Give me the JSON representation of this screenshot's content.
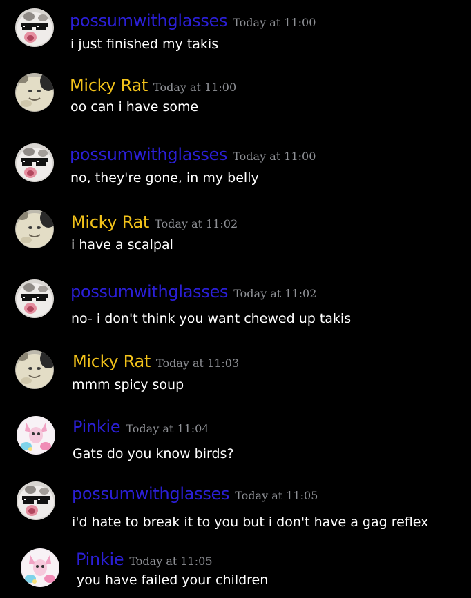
{
  "colors": {
    "background": "#000000",
    "possum_name": "#2b1fd6",
    "rat_name": "#f2c21a",
    "pinkie_name": "#2b1fd6",
    "timestamp": "#8e9095",
    "message_text": "#ffffff"
  },
  "messages": [
    {
      "author": "possumwithglasses",
      "avatar": "possum-avatar",
      "time": "Today at 11:00",
      "text": "i just finished my takis"
    },
    {
      "author": "Micky Rat",
      "avatar": "rat-avatar",
      "time": "Today at 11:00",
      "text": "oo can i have some"
    },
    {
      "author": "possumwithglasses",
      "avatar": "possum-avatar",
      "time": "Today at 11:00",
      "text": "no, they're gone, in my belly"
    },
    {
      "author": "Micky Rat",
      "avatar": "rat-avatar",
      "time": "Today at 11:02",
      "text": "i have a scalpal"
    },
    {
      "author": "possumwithglasses",
      "avatar": "possum-avatar",
      "time": "Today at 11:02",
      "text": "no- i don't think you want chewed up takis"
    },
    {
      "author": "Micky Rat",
      "avatar": "rat-avatar",
      "time": "Today at 11:03",
      "text": "mmm spicy soup"
    },
    {
      "author": "Pinkie",
      "avatar": "pinkie-avatar",
      "time": "Today at 11:04",
      "text": "Gats do you know birds?"
    },
    {
      "author": "possumwithglasses",
      "avatar": "possum-avatar",
      "time": "Today at 11:05",
      "text": "i'd hate to break it to you but i don't have a gag reflex"
    },
    {
      "author": "Pinkie",
      "avatar": "pinkie-avatar",
      "time": "Today at 11:05",
      "text": "you have failed your children"
    }
  ]
}
